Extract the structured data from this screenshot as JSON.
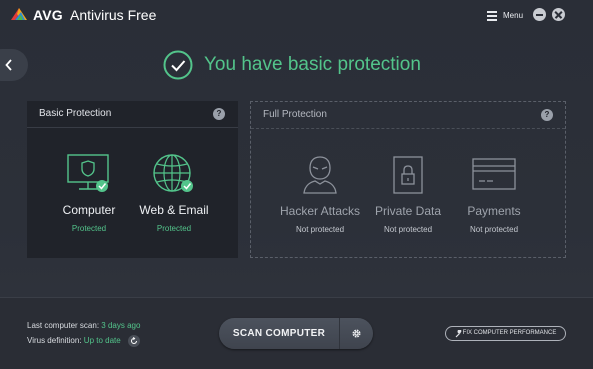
{
  "window": {
    "brand": "AVG",
    "product": "Antivirus Free",
    "menu_label": "Menu"
  },
  "status": {
    "title": "You have basic protection",
    "accent_color": "#53c48b"
  },
  "basic_panel": {
    "title": "Basic Protection",
    "help": "?",
    "items": [
      {
        "name": "Computer",
        "state": "Protected",
        "icon": "monitor-shield-icon"
      },
      {
        "name": "Web & Email",
        "state": "Protected",
        "icon": "globe-icon"
      }
    ]
  },
  "full_panel": {
    "title": "Full Protection",
    "help": "?",
    "items": [
      {
        "name": "Hacker Attacks",
        "state": "Not protected",
        "icon": "hacker-icon"
      },
      {
        "name": "Private Data",
        "state": "Not protected",
        "icon": "lock-file-icon"
      },
      {
        "name": "Payments",
        "state": "Not protected",
        "icon": "credit-card-icon"
      }
    ]
  },
  "footer": {
    "last_scan_label": "Last computer scan:",
    "last_scan_value": "3 days ago",
    "virus_def_label": "Virus definition:",
    "virus_def_value": "Up to date",
    "scan_button": "SCAN COMPUTER",
    "fix_button": "FIX COMPUTER PERFORMANCE"
  }
}
